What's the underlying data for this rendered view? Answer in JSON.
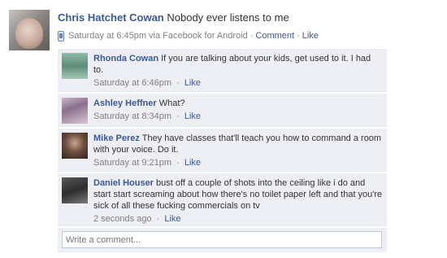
{
  "post": {
    "author": "Chris Hatchet Cowan",
    "text": "Nobody ever listens to me",
    "timestamp": "Saturday at 6:45pm via Facebook for Android",
    "device_icon": "mobile-phone-icon",
    "comment_label": "Comment",
    "like_label": "Like",
    "separator": "·"
  },
  "comments": [
    {
      "author": "Rhonda Cowan",
      "text": "If you are talking about your kids, get used to it. I had to.",
      "timestamp": "Saturday at 6:46pm",
      "like_label": "Like"
    },
    {
      "author": "Ashley Heffner",
      "text": "What?",
      "timestamp": "Saturday at 8:34pm",
      "like_label": "Like"
    },
    {
      "author": "Mike Perez",
      "text": "They have classes that'll teach you how to command a room with your voice. Do it.",
      "timestamp": "Saturday at 9:21pm",
      "like_label": "Like"
    },
    {
      "author": "Daniel Houser",
      "text": "bust off a couple of shots into the ceiling like i do and start start screaming about how there's no toilet paper left and that you're sick of all these fucking commercials on tv",
      "timestamp": "2 seconds ago",
      "like_label": "Like"
    }
  ],
  "composer": {
    "placeholder": "Write a comment..."
  },
  "colors": {
    "link": "#3b5998",
    "comment_bg": "#edeff4",
    "meta_text": "#808080"
  }
}
